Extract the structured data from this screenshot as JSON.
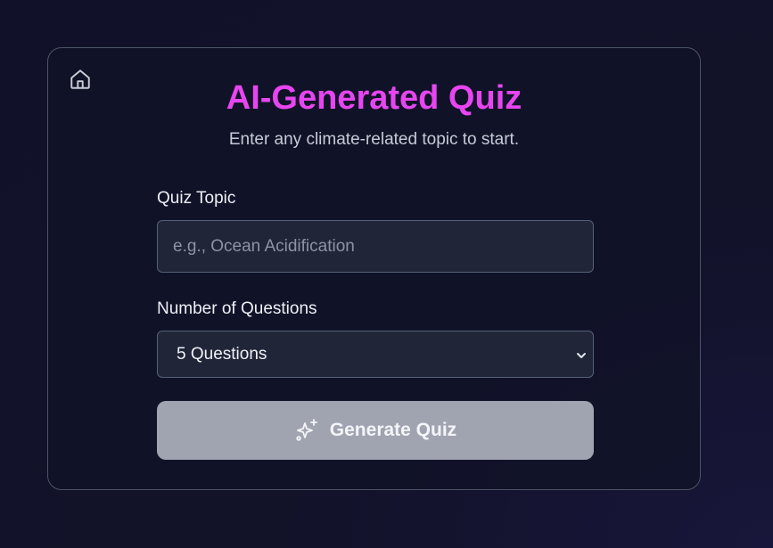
{
  "header": {
    "home_icon": "home-icon",
    "title": "AI-Generated Quiz",
    "subtitle": "Enter any climate-related topic to start."
  },
  "form": {
    "topic_label": "Quiz Topic",
    "topic_value": "",
    "topic_placeholder": "e.g., Ocean Acidification",
    "count_label": "Number of Questions",
    "count_selected": "5 Questions",
    "count_icon": "chevron-down-icon",
    "generate_label": "Generate Quiz",
    "generate_icon": "sparkles-icon"
  },
  "colors": {
    "title": "#e745f0",
    "background": "#121229",
    "button_disabled": "#a0a4b1",
    "field_bg": "#202538"
  }
}
